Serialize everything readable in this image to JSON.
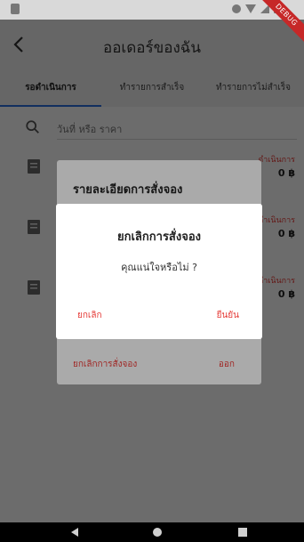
{
  "debug_banner": "DEBUG",
  "app_bar": {
    "title": "ออเดอร์ของฉัน",
    "back_icon": "arrow-back-icon"
  },
  "tabs": [
    {
      "label": "รอดำเนินการ",
      "active": true
    },
    {
      "label": "ทำรายการสำเร็จ",
      "active": false
    },
    {
      "label": "ทำรายการไม่สำเร็จ",
      "active": false
    }
  ],
  "search": {
    "placeholder": "วันที่ หรือ ราคา",
    "icon": "search-icon"
  },
  "orders": [
    {
      "status": "ดำเนินการ",
      "amount": "0 ฿"
    },
    {
      "status": "ดำเนินการ",
      "amount": "0 ฿"
    },
    {
      "status": "ดำเนินการ",
      "amount": "0 ฿"
    }
  ],
  "detail_dialog": {
    "title": "รายละเอียดการสั่งจอง",
    "cancel_order_label": "ยกเลิกการสั่งจอง",
    "exit_label": "ออก"
  },
  "confirm_dialog": {
    "title": "ยกเลิกการสั่งจอง",
    "message": "คุณแน่ใจหรือไม่ ?",
    "cancel_label": "ยกเลิก",
    "confirm_label": "ยืนยัน"
  },
  "colors": {
    "accent": "#e53935",
    "tab_indicator": "#2a6fdb"
  }
}
